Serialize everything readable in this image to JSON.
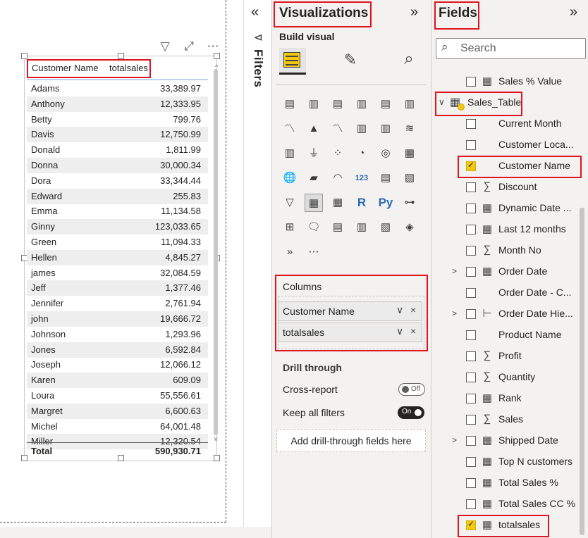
{
  "canvas": {
    "toolbar_icons": [
      "filter-icon",
      "focus-mode-icon",
      "more-options-icon"
    ],
    "toolbar_glyphs": [
      "▽",
      "⤢",
      "⋯"
    ],
    "table": {
      "columns": [
        "Customer Name",
        "totalsales"
      ],
      "rows": [
        [
          "Adams",
          "33,389.97"
        ],
        [
          "Anthony",
          "12,333.95"
        ],
        [
          "Betty",
          "799.76"
        ],
        [
          "Davis",
          "12,750.99"
        ],
        [
          "Donald",
          "1,811.99"
        ],
        [
          "Donna",
          "30,000.34"
        ],
        [
          "Dora",
          "33,344.44"
        ],
        [
          "Edward",
          "255.83"
        ],
        [
          "Emma",
          "11,134.58"
        ],
        [
          "Ginny",
          "123,033.65"
        ],
        [
          "Green",
          "11,094.33"
        ],
        [
          "Hellen",
          "4,845.27"
        ],
        [
          "james",
          "32,084.59"
        ],
        [
          "Jeff",
          "1,377.46"
        ],
        [
          "Jennifer",
          "2,761.94"
        ],
        [
          "john",
          "19,666.72"
        ],
        [
          "Johnson",
          "1,293.96"
        ],
        [
          "Jones",
          "6,592.84"
        ],
        [
          "Joseph",
          "12,066.12"
        ],
        [
          "Karen",
          "609.09"
        ],
        [
          "Loura",
          "55,556.61"
        ],
        [
          "Margret",
          "6,600.63"
        ],
        [
          "Michel",
          "64,001.48"
        ],
        [
          "Miller",
          "12,320.54"
        ]
      ],
      "total_label": "Total",
      "total_value": "590,930.71"
    }
  },
  "filters": {
    "collapse_glyph": "«",
    "label": "Filters",
    "icon_glyph": "⊲"
  },
  "visualizations": {
    "title": "Visualizations",
    "expand_glyph": "»",
    "build_visual_label": "Build visual",
    "mode_icons": [
      "build-visual-icon",
      "format-visual-icon",
      "analytics-icon"
    ],
    "gallery_glyphs": [
      "▤",
      "▥",
      "▤",
      "▥",
      "▤",
      "▥",
      "〽",
      "▲",
      "〽",
      "▥",
      "▥",
      "≋",
      "▥",
      "⏚",
      "⁘",
      "◔",
      "◎",
      "▦",
      "🌐",
      "▰",
      "◠",
      "123",
      "▤",
      "▧",
      "▽",
      "▦",
      "▦",
      "R",
      "Py",
      "⊶",
      "⊞",
      "🗨",
      "▤",
      "▥",
      "▧",
      "◈",
      "»",
      "⋯"
    ],
    "gallery_names": [
      "stacked-bar-chart-icon",
      "stacked-column-chart-icon",
      "clustered-bar-chart-icon",
      "clustered-column-chart-icon",
      "100-stacked-bar-chart-icon",
      "100-stacked-column-chart-icon",
      "line-chart-icon",
      "area-chart-icon",
      "stacked-area-chart-icon",
      "line-and-column-chart-icon",
      "line-and-clustered-column-chart-icon",
      "ribbon-chart-icon",
      "waterfall-chart-icon",
      "funnel-chart-icon",
      "scatter-chart-icon",
      "pie-chart-icon",
      "donut-chart-icon",
      "treemap-icon",
      "map-icon",
      "filled-map-icon",
      "gauge-icon",
      "card-icon",
      "multi-row-card-icon",
      "kpi-icon",
      "slicer-icon",
      "table-icon",
      "matrix-icon",
      "r-script-visual-icon",
      "python-visual-icon",
      "key-influencers-icon",
      "decomposition-tree-icon",
      "qa-icon",
      "smart-narrative-icon",
      "paginated-report-icon",
      "azure-map-icon",
      "power-apps-icon",
      "power-automate-icon",
      "more-visuals-icon"
    ],
    "columns_label": "Columns",
    "column_fields": [
      "Customer Name",
      "totalsales"
    ],
    "drill_through_label": "Drill through",
    "cross_report_label": "Cross-report",
    "cross_report_state": "Off",
    "keep_filters_label": "Keep all filters",
    "keep_filters_state": "On",
    "add_drill_label": "Add drill-through fields here"
  },
  "fields": {
    "title": "Fields",
    "expand_glyph": "»",
    "search_placeholder": "Search",
    "items": [
      {
        "name": "Sales % Value",
        "type": "calc",
        "checked": false,
        "expander": false
      },
      {
        "name": "Sales_Table",
        "type": "table",
        "checked": false,
        "expander": true,
        "is_table": true
      },
      {
        "name": "Current Month",
        "type": "none",
        "checked": false,
        "expander": false
      },
      {
        "name": "Customer Loca...",
        "type": "none",
        "checked": false,
        "expander": false
      },
      {
        "name": "Customer Name",
        "type": "none",
        "checked": true,
        "expander": false
      },
      {
        "name": "Discount",
        "type": "sigma",
        "checked": false,
        "expander": false
      },
      {
        "name": "Dynamic Date ...",
        "type": "calc",
        "checked": false,
        "expander": false
      },
      {
        "name": "Last 12 months",
        "type": "calc",
        "checked": false,
        "expander": false
      },
      {
        "name": "Month No",
        "type": "sigma",
        "checked": false,
        "expander": false
      },
      {
        "name": "Order Date",
        "type": "calendar",
        "checked": false,
        "expander": true
      },
      {
        "name": "Order Date - C...",
        "type": "none",
        "checked": false,
        "expander": false
      },
      {
        "name": "Order Date Hie...",
        "type": "hierarchy",
        "checked": false,
        "expander": true
      },
      {
        "name": "Product Name",
        "type": "none",
        "checked": false,
        "expander": false
      },
      {
        "name": "Profit",
        "type": "sigma",
        "checked": false,
        "expander": false
      },
      {
        "name": "Quantity",
        "type": "sigma",
        "checked": false,
        "expander": false
      },
      {
        "name": "Rank",
        "type": "calc",
        "checked": false,
        "expander": false
      },
      {
        "name": "Sales",
        "type": "sigma",
        "checked": false,
        "expander": false
      },
      {
        "name": "Shipped Date",
        "type": "calendar",
        "checked": false,
        "expander": true
      },
      {
        "name": "Top N customers",
        "type": "calc",
        "checked": false,
        "expander": false
      },
      {
        "name": "Total Sales %",
        "type": "calc",
        "checked": false,
        "expander": false
      },
      {
        "name": "Total Sales CC %",
        "type": "calctable",
        "checked": false,
        "expander": false
      },
      {
        "name": "totalsales",
        "type": "calc",
        "checked": true,
        "expander": false
      }
    ]
  },
  "colors": {
    "highlight_red": "#e0141e",
    "checkbox_yellow": "#f2c811",
    "pane_bg": "#f3f2f1"
  }
}
